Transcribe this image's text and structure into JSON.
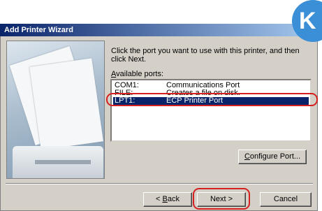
{
  "window": {
    "title": "Add Printer Wizard"
  },
  "logo": {
    "letter": "K"
  },
  "instruction": "Click the port you want to use with this printer, and then click Next.",
  "ports": {
    "label_prefix": "",
    "label_accel": "A",
    "label_rest": "vailable ports:",
    "items": [
      {
        "port": "COM1:",
        "description": "Communications Port",
        "selected": false
      },
      {
        "port": "FILE:",
        "description": "Creates a file on disk.",
        "selected": false
      },
      {
        "port": "LPT1:",
        "description": "ECP Printer Port",
        "selected": true
      }
    ]
  },
  "buttons": {
    "configure": {
      "accel": "C",
      "rest": "onfigure Port..."
    },
    "back": {
      "prefix": "< ",
      "accel": "B",
      "rest": "ack"
    },
    "next": {
      "label": "Next >"
    },
    "cancel": {
      "label": "Cancel"
    }
  },
  "colors": {
    "selection": "#0a246a",
    "annotation": "#d62020",
    "face": "#d4d0c8"
  }
}
